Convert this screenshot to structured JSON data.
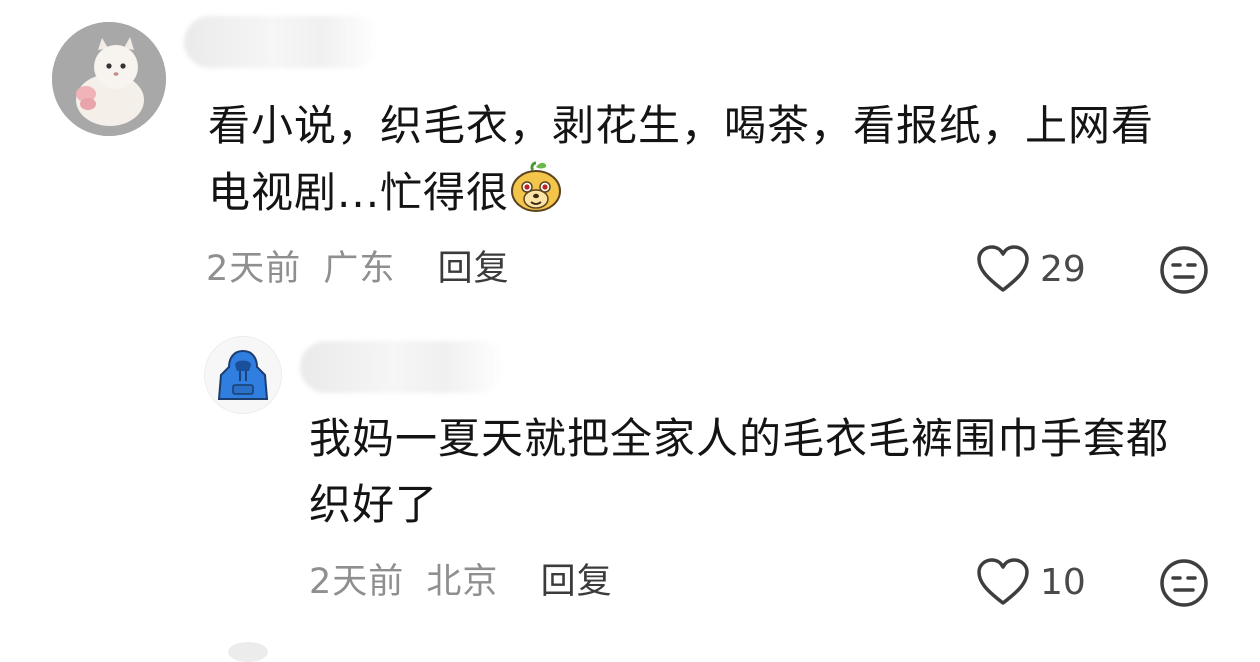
{
  "comments": [
    {
      "text_line1": "看小说，织毛衣，剥花生，喝茶，看报纸，上网看",
      "text_line2": "电视剧...忙得很",
      "emoji": "doge-face-emoji",
      "time": "2天前",
      "location": "广东",
      "reply_label": "回复",
      "like_count": "29"
    },
    {
      "text_line1": "我妈一夏天就把全家人的毛衣毛裤围巾手套都",
      "text_line2": "织好了",
      "time": "2天前",
      "location": "北京",
      "reply_label": "回复",
      "like_count": "10"
    }
  ],
  "icons": {
    "like": "heart-outline-icon",
    "dislike": "meh-face-icon",
    "avatar1": "white-cat-avatar",
    "avatar2": "blue-hoodie-avatar"
  },
  "colors": {
    "text": "#141414",
    "meta": "#8f8f8f",
    "hoodie": "#2f7ee0"
  }
}
